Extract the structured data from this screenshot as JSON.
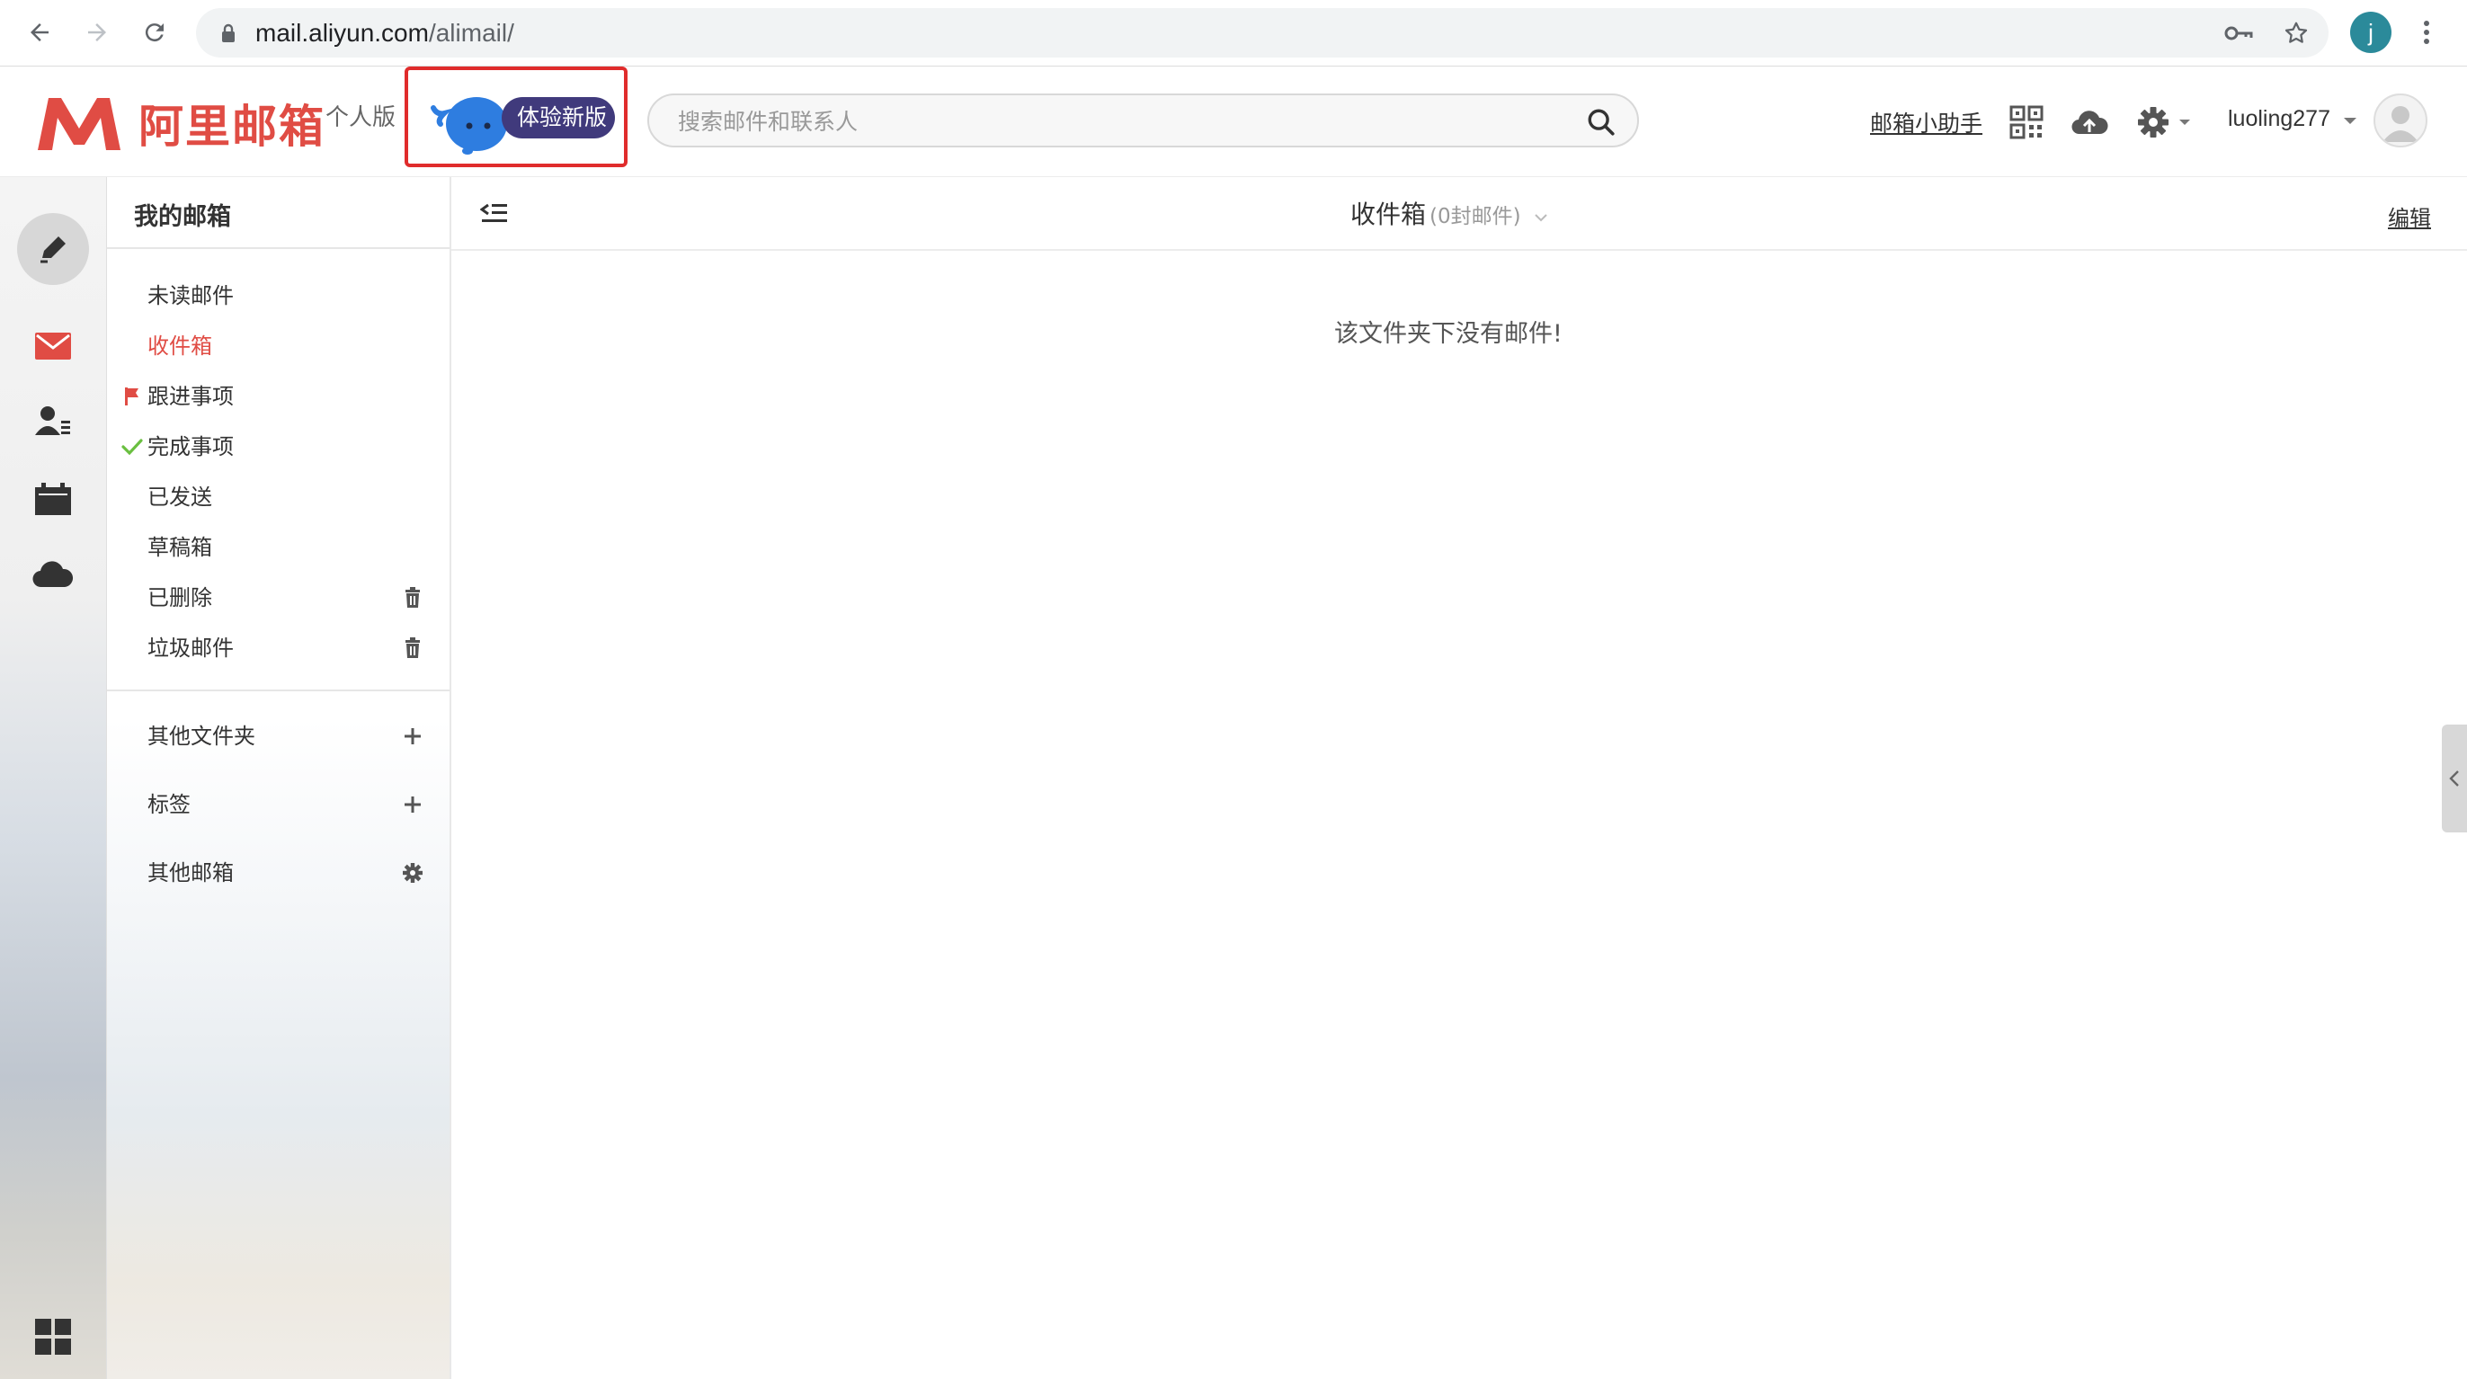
{
  "browser": {
    "url_host": "mail.aliyun.com",
    "url_path": "/alimail/",
    "profile_initial": "j"
  },
  "header": {
    "logo_text": "阿里邮箱",
    "edition": "个人版",
    "new_version_label": "体验新版",
    "search_placeholder": "搜索邮件和联系人",
    "assistant_link": "邮箱小助手",
    "username": "luoling277",
    "brand_color": "#e04c44"
  },
  "rail": {
    "items": [
      "compose-icon",
      "mail-icon",
      "contacts-icon",
      "calendar-icon",
      "cloud-icon",
      "apps-grid-icon"
    ]
  },
  "folders": {
    "title": "我的邮箱",
    "items": [
      {
        "label": "未读邮件"
      },
      {
        "label": "收件箱",
        "active": true
      },
      {
        "label": "跟进事项",
        "mark": "flag-icon"
      },
      {
        "label": "完成事项",
        "mark": "check-icon"
      },
      {
        "label": "已发送"
      },
      {
        "label": "草稿箱"
      },
      {
        "label": "已删除",
        "action": "trash-icon"
      },
      {
        "label": "垃圾邮件",
        "action": "trash-icon"
      }
    ],
    "other_folders": "其他文件夹",
    "tags": "标签",
    "other_mailboxes": "其他邮箱"
  },
  "main": {
    "folder_title": "收件箱",
    "folder_count": "(0封邮件)",
    "edit_label": "编辑",
    "empty_message": "该文件夹下没有邮件!"
  }
}
